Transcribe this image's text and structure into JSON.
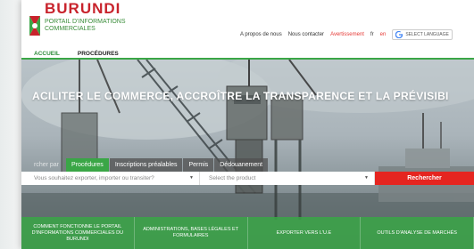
{
  "brand": {
    "title": "BURUNDI",
    "subtitle": "PORTAIL D'INFORMATIONS COMMERCIALES",
    "colors": {
      "red": "#c8232c",
      "green": "#3aa646"
    }
  },
  "top_nav": {
    "about": "A propos de nous",
    "contact": "Nous contacter",
    "warning": "Avertissement",
    "lang_fr": "fr",
    "lang_en": "en",
    "select_language": "SELECT LANGUAGE"
  },
  "main_nav": {
    "home": "ACCUEIL",
    "procedures": "PROCÉDURES"
  },
  "hero": {
    "headline": "ACILITER LE COMMERCE, ACCROÎTRE LA TRANSPARENCE ET LA PRÉVISIBI"
  },
  "tabs": {
    "lead": "rcher par",
    "items": [
      "Procédures",
      "Inscriptions préalables",
      "Permis",
      "Dédouanement"
    ]
  },
  "search": {
    "field1_placeholder": "Vous souhaitez exporter, importer ou transiter?",
    "field2_placeholder": "Select the product",
    "button": "Rechercher"
  },
  "boxes": [
    "COMMENT FONCTIONNE LE PORTAIL D'INFORMATIONS COMMERCIALES DU BURUNDI",
    "ADMINISTRATIONS, BASES LÉGALES ET FORMULAIRES",
    "EXPORTER VERS L'U.E",
    "OUTILS D'ANALYSE DE MARCHÉS"
  ]
}
